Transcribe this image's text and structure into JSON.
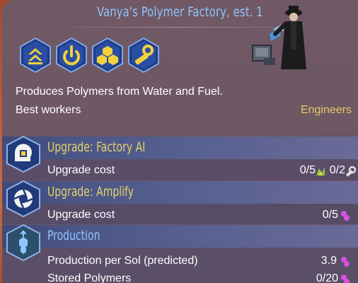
{
  "building": {
    "title": "Vanya's Polymer Factory, est. 1",
    "description": "Produces Polymers from Water and Fuel.",
    "best_workers_label": "Best workers",
    "best_workers_value": "Engineers"
  },
  "badges": [
    {
      "icon": "double-chevron-up-icon"
    },
    {
      "icon": "power-icon"
    },
    {
      "icon": "cubes-icon"
    },
    {
      "icon": "gear-pipe-icon"
    }
  ],
  "sections": [
    {
      "title": "Upgrade: Factory AI",
      "title_color": "#e6d36a",
      "icon": "ai-chip-head-icon",
      "rows": [
        {
          "label": "Upgrade cost",
          "value_1": "0/5",
          "value_2": "0/2"
        }
      ]
    },
    {
      "title": "Upgrade: Amplify",
      "title_color": "#e6d36a",
      "icon": "aperture-icon",
      "rows": [
        {
          "label": "Upgrade cost",
          "value_1": "0/5"
        }
      ]
    },
    {
      "title": "Production",
      "title_color": "#8ec5ff",
      "icon": "polymer-hex-icon",
      "rows": [
        {
          "label": "Production per Sol (predicted)",
          "value": "3.9"
        },
        {
          "label": "Stored Polymers",
          "value": "0/20"
        }
      ]
    }
  ],
  "colors": {
    "panel": "#6b5763",
    "title": "#8ec5ff",
    "accent_gold": "#e6c76a",
    "polymer_pink": "#d94fe3",
    "metals_green": "#8bc34a"
  }
}
